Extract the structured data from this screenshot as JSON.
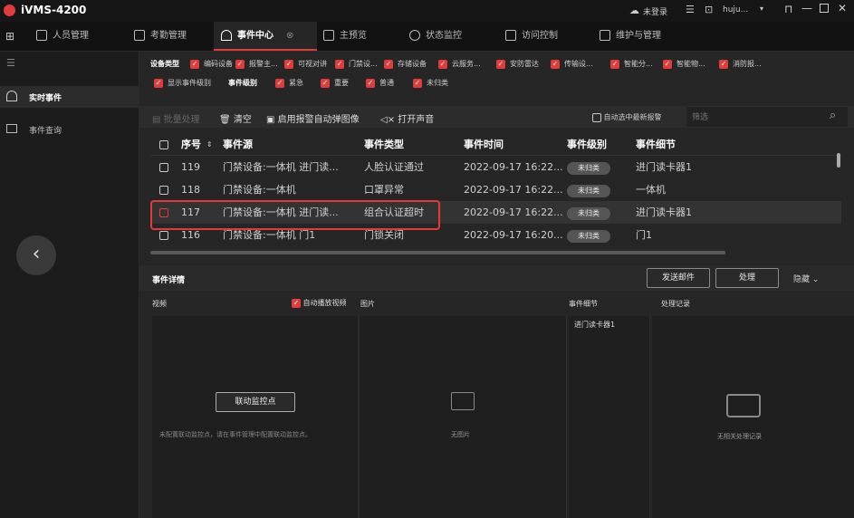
{
  "app": {
    "title": "iVMS-4200",
    "login_status": "未登录",
    "user": "huju..."
  },
  "tabs": [
    {
      "label": "人员管理"
    },
    {
      "label": "考勤管理"
    },
    {
      "label": "事件中心"
    },
    {
      "label": "主预览"
    },
    {
      "label": "状态监控"
    },
    {
      "label": "访问控制"
    },
    {
      "label": "维护与管理"
    }
  ],
  "sidebar": {
    "items": [
      {
        "label": "实时事件"
      },
      {
        "label": "事件查询"
      }
    ]
  },
  "filters": {
    "row1_label": "设备类型",
    "row1": [
      "编码设备",
      "报警主...",
      "可视对讲",
      "门禁设...",
      "存储设备",
      "云服务...",
      "安防雷达",
      "传输设...",
      "智能分...",
      "智能物...",
      "消防报..."
    ],
    "row2": [
      "显示事件级别",
      "事件级别",
      "紧急",
      "重要",
      "普通",
      "未归类"
    ]
  },
  "toolbar": {
    "batch": "批量处理",
    "clear": "清空",
    "popup": "启用报警自动弹图像",
    "sound": "打开声音",
    "auto_select": "自动选中最新报警",
    "filter_placeholder": "筛选"
  },
  "table": {
    "headers": [
      "序号",
      "事件源",
      "事件类型",
      "事件时间",
      "事件级别",
      "事件细节"
    ],
    "rows": [
      [
        "119",
        "门禁设备:一体机 进门读...",
        "人脸认证通过",
        "2022-09-17 16:22...",
        "未归类",
        "进门读卡器1"
      ],
      [
        "118",
        "门禁设备:一体机",
        "口罩异常",
        "2022-09-17 16:22...",
        "未归类",
        "一体机"
      ],
      [
        "117",
        "门禁设备:一体机 进门读...",
        "组合认证超时",
        "2022-09-17 16:22...",
        "未归类",
        "进门读卡器1"
      ],
      [
        "116",
        "门禁设备:一体机 门1",
        "门锁关闭",
        "2022-09-17 16:20...",
        "未归类",
        "门1"
      ]
    ]
  },
  "detail": {
    "title": "事件详情",
    "send_email": "发送邮件",
    "handle": "处理",
    "hide": "隐藏",
    "video_label": "视频",
    "autoplay": "自动播放视频",
    "picture_label": "图片",
    "detail_label": "事件细节",
    "record_label": "处理记录",
    "link_button": "联动监控点",
    "no_link_text": "未配置联动监控点，请在事件管理中配置联动监控点。",
    "no_picture": "无图片",
    "detail_value": "进门读卡器1",
    "no_record": "无相关处理记录"
  },
  "colors": {
    "accent": "#e03c3c",
    "highlight_border": "#e53935"
  }
}
